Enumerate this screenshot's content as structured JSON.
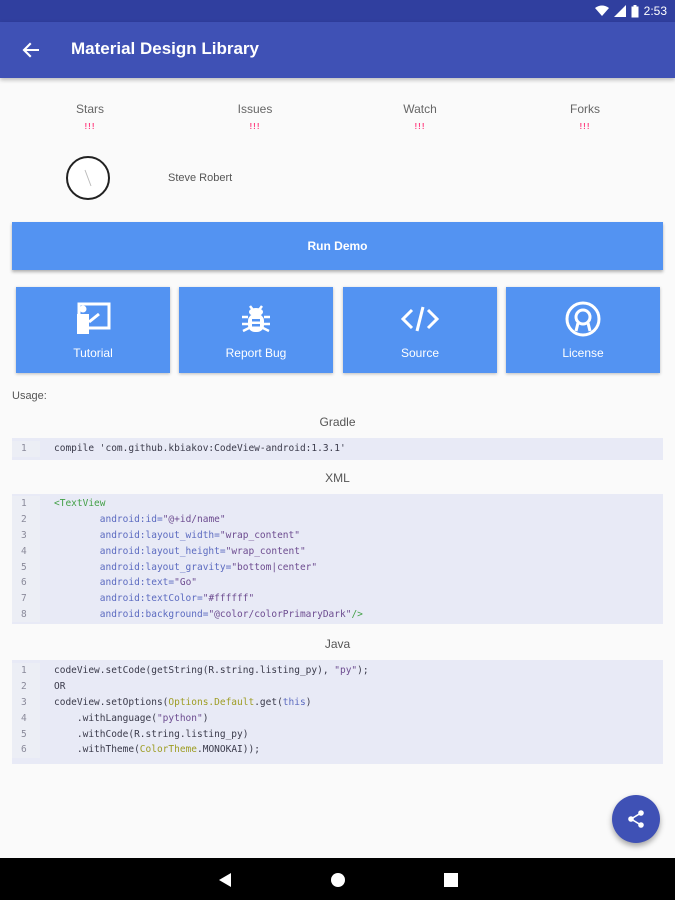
{
  "status_bar": {
    "time": "2:53"
  },
  "app_bar": {
    "title": "Material Design Library"
  },
  "stats": [
    {
      "label": "Stars",
      "value": "!!!"
    },
    {
      "label": "Issues",
      "value": "!!!"
    },
    {
      "label": "Watch",
      "value": "!!!"
    },
    {
      "label": "Forks",
      "value": "!!!"
    }
  ],
  "author": {
    "name": "Steve Robert"
  },
  "run_demo": {
    "label": "Run Demo"
  },
  "tiles": [
    {
      "label": "Tutorial",
      "icon": "tutorial-icon"
    },
    {
      "label": "Report Bug",
      "icon": "bug-icon"
    },
    {
      "label": "Source",
      "icon": "code-icon"
    },
    {
      "label": "License",
      "icon": "license-icon"
    }
  ],
  "usage_label": "Usage:",
  "sections": {
    "gradle": {
      "title": "Gradle",
      "lines": [
        {
          "n": "1",
          "parts": [
            [
              "plain",
              "compile 'com.github.kbiakov:CodeView-android:1.3.1'"
            ]
          ]
        }
      ]
    },
    "xml": {
      "title": "XML",
      "lines": [
        {
          "n": "1",
          "parts": [
            [
              "tag",
              "<TextView"
            ]
          ]
        },
        {
          "n": "2",
          "parts": [
            [
              "plain",
              "        "
            ],
            [
              "attr",
              "android:id="
            ],
            [
              "str",
              "\"@+id/name\""
            ]
          ]
        },
        {
          "n": "3",
          "parts": [
            [
              "plain",
              "        "
            ],
            [
              "attr",
              "android:layout_width="
            ],
            [
              "str",
              "\"wrap_content\""
            ]
          ]
        },
        {
          "n": "4",
          "parts": [
            [
              "plain",
              "        "
            ],
            [
              "attr",
              "android:layout_height="
            ],
            [
              "str",
              "\"wrap_content\""
            ]
          ]
        },
        {
          "n": "5",
          "parts": [
            [
              "plain",
              "        "
            ],
            [
              "attr",
              "android:layout_gravity="
            ],
            [
              "str",
              "\"bottom|center\""
            ]
          ]
        },
        {
          "n": "6",
          "parts": [
            [
              "plain",
              "        "
            ],
            [
              "attr",
              "android:text="
            ],
            [
              "str",
              "\"Go\""
            ]
          ]
        },
        {
          "n": "7",
          "parts": [
            [
              "plain",
              "        "
            ],
            [
              "attr",
              "android:textColor="
            ],
            [
              "str",
              "\"#ffffff\""
            ]
          ]
        },
        {
          "n": "8",
          "parts": [
            [
              "plain",
              "        "
            ],
            [
              "attr",
              "android:background="
            ],
            [
              "str",
              "\"@color/colorPrimaryDark\""
            ],
            [
              "tag",
              "/>"
            ]
          ]
        }
      ]
    },
    "java": {
      "title": "Java",
      "lines": [
        {
          "n": "1",
          "parts": [
            [
              "plain",
              "codeView.setCode(getString(R.string.listing_py), "
            ],
            [
              "str",
              "\"py\""
            ],
            [
              "plain",
              ");"
            ]
          ]
        },
        {
          "n": "2",
          "parts": [
            [
              "plain",
              "OR"
            ]
          ]
        },
        {
          "n": "3",
          "parts": [
            [
              "plain",
              "codeView.setOptions("
            ],
            [
              "cls",
              "Options.Default"
            ],
            [
              "plain",
              ".get("
            ],
            [
              "kw",
              "this"
            ],
            [
              "plain",
              ")"
            ]
          ]
        },
        {
          "n": "4",
          "parts": [
            [
              "plain",
              "    .withLanguage("
            ],
            [
              "str",
              "\"python\""
            ],
            [
              "plain",
              ")"
            ]
          ]
        },
        {
          "n": "5",
          "parts": [
            [
              "plain",
              "    .withCode(R.string.listing_py)"
            ]
          ]
        },
        {
          "n": "6",
          "parts": [
            [
              "plain",
              "    .withTheme("
            ],
            [
              "cls",
              "ColorTheme"
            ],
            [
              "plain",
              ".MONOKAI));"
            ]
          ]
        }
      ]
    }
  },
  "colors": {
    "primary": "#3f51b5",
    "primary_dark": "#303f9f",
    "tile": "#5393f2",
    "accent": "#ff4081"
  }
}
